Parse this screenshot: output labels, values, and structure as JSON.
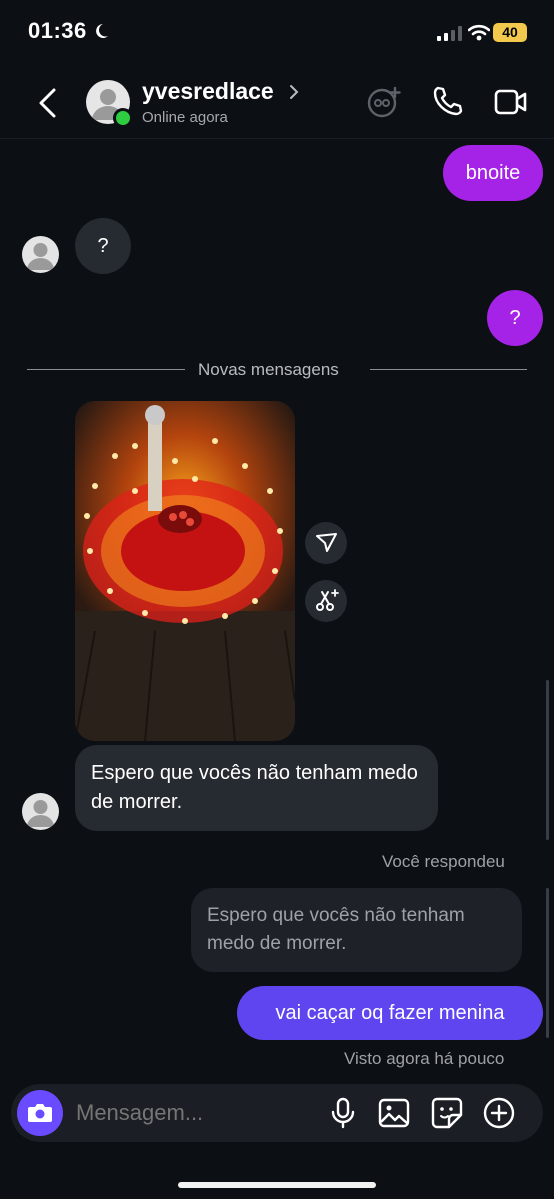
{
  "status_bar": {
    "time": "01:36",
    "battery": "40",
    "icons": [
      "moon-icon",
      "signal-icon",
      "wifi-icon",
      "battery-icon"
    ]
  },
  "header": {
    "username": "yvesredlace",
    "status": "Online agora",
    "icons": [
      "back-icon",
      "chevron-right-icon",
      "add-people-icon",
      "phone-icon",
      "video-icon"
    ]
  },
  "messages": {
    "m1": "bnoite",
    "m2": "?",
    "m3": "?",
    "new_messages_label": "Novas mensagens",
    "m4": "Espero que vocês não tenham medo de morrer.",
    "replied_label": "Você respondeu",
    "quote": "Espero que vocês não tenham medo de morrer.",
    "m5": "vai caçar oq fazer menina",
    "seen": "Visto agora há pouco"
  },
  "composer": {
    "placeholder": "Mensagem...",
    "icons": [
      "camera-icon",
      "mic-icon",
      "gallery-icon",
      "sticker-icon",
      "plus-icon"
    ]
  },
  "colors": {
    "background": "#0c0f14",
    "sent_bubble_purple": "#a523e6",
    "sent_bubble_blue": "#5f45f0",
    "received_bubble": "#262a31",
    "online": "#2ecc40",
    "camera_button": "#6a4bff"
  }
}
